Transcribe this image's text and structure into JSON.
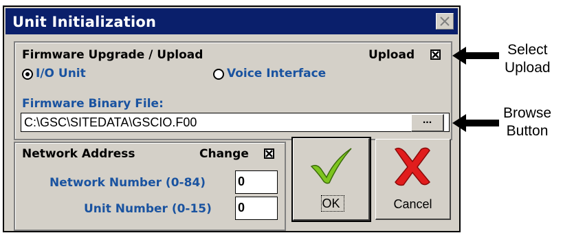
{
  "dialog": {
    "title": "Unit Initialization",
    "close_icon": "close-x-icon"
  },
  "firmware": {
    "group_label": "Firmware Upgrade / Upload",
    "upload_label": "Upload",
    "upload_checked": true,
    "radio_io_label": "I/O Unit",
    "radio_io_selected": true,
    "radio_voice_label": "Voice Interface",
    "radio_voice_selected": false,
    "file_label": "Firmware Binary File:",
    "file_value": "C:\\GSC\\SITEDATA\\GSCIO.F00",
    "browse_label": "..."
  },
  "network": {
    "group_label": "Network Address",
    "change_label": "Change",
    "change_checked": true,
    "network_number_label": "Network Number (0-84)",
    "network_number_value": "0",
    "unit_number_label": "Unit Number (0-15)",
    "unit_number_value": "0"
  },
  "buttons": {
    "ok_label": "OK",
    "cancel_label": "Cancel"
  },
  "annotations": {
    "select_upload_line1": "Select",
    "select_upload_line2": "Upload",
    "browse_line1": "Browse",
    "browse_line2": "Button"
  },
  "colors": {
    "titlebar": "#0a1f6b",
    "blue_label": "#1a53a0",
    "dialog_bg": "#d4d0c8",
    "ok_check": "#7ec51f",
    "cancel_x": "#e11d1d"
  }
}
